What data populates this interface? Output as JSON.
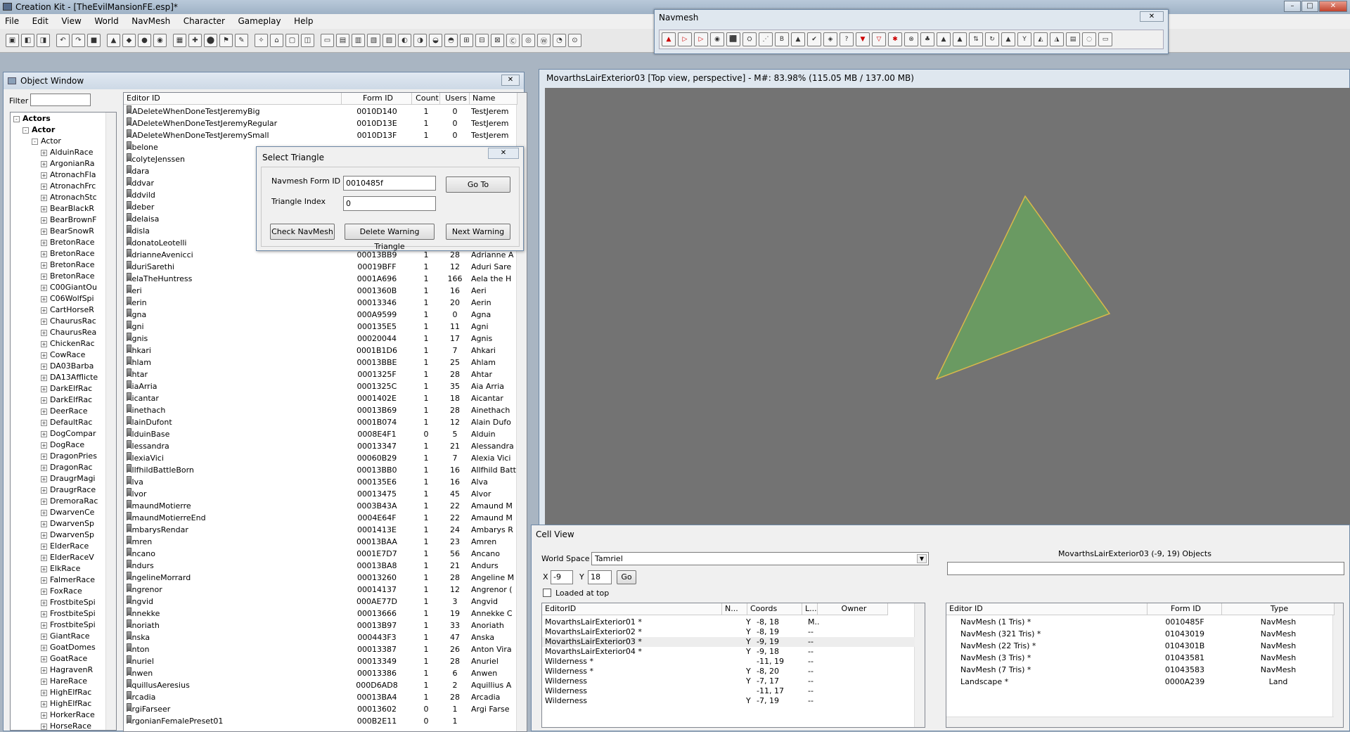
{
  "app": {
    "title": "Creation Kit - [TheEvilMansionFE.esp]*"
  },
  "menu": [
    "File",
    "Edit",
    "View",
    "World",
    "NavMesh",
    "Character",
    "Gameplay",
    "Help"
  ],
  "navmesh_window": {
    "title": "Navmesh",
    "close": "✕"
  },
  "object_window": {
    "title": "Object Window",
    "filter_label": "Filter",
    "filter_value": "",
    "tree": [
      {
        "label": "Actors",
        "bold": true,
        "level": 0,
        "exp": "-"
      },
      {
        "label": "Actor",
        "bold": true,
        "level": 1,
        "exp": "-"
      },
      {
        "label": "Actor",
        "bold": false,
        "level": 2,
        "exp": "-"
      },
      {
        "label": "AlduinRace",
        "level": 3,
        "exp": "+"
      },
      {
        "label": "ArgonianRa",
        "level": 3,
        "exp": "+"
      },
      {
        "label": "AtronachFla",
        "level": 3,
        "exp": "+"
      },
      {
        "label": "AtronachFrc",
        "level": 3,
        "exp": "+"
      },
      {
        "label": "AtronachStc",
        "level": 3,
        "exp": "+"
      },
      {
        "label": "BearBlackR",
        "level": 3,
        "exp": "+"
      },
      {
        "label": "BearBrownF",
        "level": 3,
        "exp": "+"
      },
      {
        "label": "BearSnowR",
        "level": 3,
        "exp": "+"
      },
      {
        "label": "BretonRace",
        "level": 3,
        "exp": "+"
      },
      {
        "label": "BretonRace",
        "level": 3,
        "exp": "+"
      },
      {
        "label": "BretonRace",
        "level": 3,
        "exp": "+"
      },
      {
        "label": "BretonRace",
        "level": 3,
        "exp": "+"
      },
      {
        "label": "C00GiantOu",
        "level": 3,
        "exp": "+"
      },
      {
        "label": "C06WolfSpi",
        "level": 3,
        "exp": "+"
      },
      {
        "label": "CartHorseR",
        "level": 3,
        "exp": "+"
      },
      {
        "label": "ChaurusRac",
        "level": 3,
        "exp": "+"
      },
      {
        "label": "ChaurusRea",
        "level": 3,
        "exp": "+"
      },
      {
        "label": "ChickenRac",
        "level": 3,
        "exp": "+"
      },
      {
        "label": "CowRace",
        "level": 3,
        "exp": "+"
      },
      {
        "label": "DA03Barba",
        "level": 3,
        "exp": "+"
      },
      {
        "label": "DA13Afflicte",
        "level": 3,
        "exp": "+"
      },
      {
        "label": "DarkElfRac",
        "level": 3,
        "exp": "+"
      },
      {
        "label": "DarkElfRac",
        "level": 3,
        "exp": "+"
      },
      {
        "label": "DeerRace",
        "level": 3,
        "exp": "+"
      },
      {
        "label": "DefaultRac",
        "level": 3,
        "exp": "+"
      },
      {
        "label": "DogCompar",
        "level": 3,
        "exp": "+"
      },
      {
        "label": "DogRace",
        "level": 3,
        "exp": "+"
      },
      {
        "label": "DragonPries",
        "level": 3,
        "exp": "+"
      },
      {
        "label": "DragonRac",
        "level": 3,
        "exp": "+"
      },
      {
        "label": "DraugrMagi",
        "level": 3,
        "exp": "+"
      },
      {
        "label": "DraugrRace",
        "level": 3,
        "exp": "+"
      },
      {
        "label": "DremoraRac",
        "level": 3,
        "exp": "+"
      },
      {
        "label": "DwarvenCe",
        "level": 3,
        "exp": "+"
      },
      {
        "label": "DwarvenSp",
        "level": 3,
        "exp": "+"
      },
      {
        "label": "DwarvenSp",
        "level": 3,
        "exp": "+"
      },
      {
        "label": "ElderRace",
        "level": 3,
        "exp": "+"
      },
      {
        "label": "ElderRaceV",
        "level": 3,
        "exp": "+"
      },
      {
        "label": "ElkRace",
        "level": 3,
        "exp": "+"
      },
      {
        "label": "FalmerRace",
        "level": 3,
        "exp": "+"
      },
      {
        "label": "FoxRace",
        "level": 3,
        "exp": "+"
      },
      {
        "label": "FrostbiteSpi",
        "level": 3,
        "exp": "+"
      },
      {
        "label": "FrostbiteSpi",
        "level": 3,
        "exp": "+"
      },
      {
        "label": "FrostbiteSpi",
        "level": 3,
        "exp": "+"
      },
      {
        "label": "GiantRace",
        "level": 3,
        "exp": "+"
      },
      {
        "label": "GoatDomes",
        "level": 3,
        "exp": "+"
      },
      {
        "label": "GoatRace",
        "level": 3,
        "exp": "+"
      },
      {
        "label": "HagravenR",
        "level": 3,
        "exp": "+"
      },
      {
        "label": "HareRace",
        "level": 3,
        "exp": "+"
      },
      {
        "label": "HighElfRac",
        "level": 3,
        "exp": "+"
      },
      {
        "label": "HighElfRac",
        "level": 3,
        "exp": "+"
      },
      {
        "label": "HorkerRace",
        "level": 3,
        "exp": "+"
      },
      {
        "label": "HorseRace",
        "level": 3,
        "exp": "+"
      }
    ],
    "columns": [
      "Editor ID",
      "Form ID",
      "Count",
      "Users",
      "Name"
    ],
    "rows": [
      [
        "AADeleteWhenDoneTestJeremyBig",
        "0010D140",
        "1",
        "0",
        "TestJerem"
      ],
      [
        "AADeleteWhenDoneTestJeremyRegular",
        "0010D13E",
        "1",
        "0",
        "TestJerem"
      ],
      [
        "AADeleteWhenDoneTestJeremySmall",
        "0010D13F",
        "1",
        "0",
        "TestJerem"
      ],
      [
        "Abelone",
        "",
        "",
        "",
        ""
      ],
      [
        "AcolyteJenssen",
        "",
        "",
        "",
        ""
      ],
      [
        "Adara",
        "",
        "",
        "",
        ""
      ],
      [
        "Addvar",
        "",
        "",
        "",
        ""
      ],
      [
        "Addvild",
        "",
        "",
        "",
        ""
      ],
      [
        "Adeber",
        "",
        "",
        "",
        ""
      ],
      [
        "Adelaisa",
        "",
        "",
        "",
        ""
      ],
      [
        "Adisla",
        "",
        "",
        "",
        ""
      ],
      [
        "AdonatoLeotelli",
        "",
        "",
        "",
        ""
      ],
      [
        "AdrianneAvenicci",
        "00013BB9",
        "1",
        "28",
        "Adrianne A"
      ],
      [
        "AduriSarethi",
        "00019BFF",
        "1",
        "12",
        "Aduri Sare"
      ],
      [
        "AelaTheHuntress",
        "0001A696",
        "1",
        "166",
        "Aela the H"
      ],
      [
        "Aeri",
        "0001360B",
        "1",
        "16",
        "Aeri"
      ],
      [
        "Aerin",
        "00013346",
        "1",
        "20",
        "Aerin"
      ],
      [
        "Agna",
        "000A9599",
        "1",
        "0",
        "Agna"
      ],
      [
        "Agni",
        "000135E5",
        "1",
        "11",
        "Agni"
      ],
      [
        "Agnis",
        "00020044",
        "1",
        "17",
        "Agnis"
      ],
      [
        "Ahkari",
        "0001B1D6",
        "1",
        "7",
        "Ahkari"
      ],
      [
        "Ahlam",
        "00013BBE",
        "1",
        "25",
        "Ahlam"
      ],
      [
        "Ahtar",
        "0001325F",
        "1",
        "28",
        "Ahtar"
      ],
      [
        "AiaArria",
        "0001325C",
        "1",
        "35",
        "Aia Arria"
      ],
      [
        "Aicantar",
        "0001402E",
        "1",
        "18",
        "Aicantar"
      ],
      [
        "Ainethach",
        "00013B69",
        "1",
        "28",
        "Ainethach"
      ],
      [
        "AlainDufont",
        "0001B074",
        "1",
        "12",
        "Alain Dufo"
      ],
      [
        "AlduinBase",
        "0008E4F1",
        "0",
        "5",
        "Alduin"
      ],
      [
        "Alessandra",
        "00013347",
        "1",
        "21",
        "Alessandra"
      ],
      [
        "AlexiaVici",
        "00060B29",
        "1",
        "7",
        "Alexia Vici"
      ],
      [
        "AllfhildBattleBorn",
        "00013BB0",
        "1",
        "16",
        "Allfhild Batt"
      ],
      [
        "Alva",
        "000135E6",
        "1",
        "16",
        "Alva"
      ],
      [
        "Alvor",
        "00013475",
        "1",
        "45",
        "Alvor"
      ],
      [
        "AmaundMotierre",
        "0003B43A",
        "1",
        "22",
        "Amaund M"
      ],
      [
        "AmaundMotierreEnd",
        "0004E64F",
        "1",
        "22",
        "Amaund M"
      ],
      [
        "AmbarysRendar",
        "0001413E",
        "1",
        "24",
        "Ambarys R"
      ],
      [
        "Amren",
        "00013BAA",
        "1",
        "23",
        "Amren"
      ],
      [
        "Ancano",
        "0001E7D7",
        "1",
        "56",
        "Ancano"
      ],
      [
        "Andurs",
        "00013BA8",
        "1",
        "21",
        "Andurs"
      ],
      [
        "AngelineMorrard",
        "00013260",
        "1",
        "28",
        "Angeline M"
      ],
      [
        "Angrenor",
        "00014137",
        "1",
        "12",
        "Angrenor ("
      ],
      [
        "Angvid",
        "000AE77D",
        "1",
        "3",
        "Angvid"
      ],
      [
        "Annekke",
        "00013666",
        "1",
        "19",
        "Annekke C"
      ],
      [
        "Anoriath",
        "00013B97",
        "1",
        "33",
        "Anoriath"
      ],
      [
        "Anska",
        "000443F3",
        "1",
        "47",
        "Anska"
      ],
      [
        "Anton",
        "00013387",
        "1",
        "26",
        "Anton Vira"
      ],
      [
        "Anuriel",
        "00013349",
        "1",
        "28",
        "Anuriel"
      ],
      [
        "Anwen",
        "00013386",
        "1",
        "6",
        "Anwen"
      ],
      [
        "AquillusAeresius",
        "000D6AD8",
        "1",
        "2",
        "Aquillius A"
      ],
      [
        "Arcadia",
        "00013BA4",
        "1",
        "28",
        "Arcadia"
      ],
      [
        "ArgiFarseer",
        "00013602",
        "0",
        "1",
        "Argi Farse"
      ],
      [
        "ArgonianFemalePreset01",
        "000B2E11",
        "0",
        "1",
        ""
      ]
    ]
  },
  "select_triangle": {
    "title": "Select Triangle",
    "close": "✕",
    "navmesh_form_id_label": "Navmesh Form ID",
    "navmesh_form_id_value": "0010485f",
    "triangle_index_label": "Triangle Index",
    "triangle_index_value": "0",
    "goto": "Go To",
    "check": "Check NavMesh",
    "delete_warning": "Delete Warning Triangle",
    "next_warning": "Next Warning"
  },
  "render_window": {
    "title": "MovarthsLairExterior03 [Top view, perspective] - M#: 83.98% (115.05 MB / 137.00 MB)",
    "bg": "#737373",
    "triangle_fill": "#6a9a62",
    "triangle_edge": "#d8b84a"
  },
  "cell_view": {
    "title": "Cell View",
    "world_space_label": "World Space",
    "world_space_value": "Tamriel",
    "x_label": "X",
    "x_value": "-9",
    "y_label": "Y",
    "y_value": "18",
    "go": "Go",
    "loaded_at_top": "Loaded at top",
    "objects_title": "MovarthsLairExterior03 (-9, 19) Objects",
    "cells_columns": [
      "EditorID",
      "N...",
      "Coords",
      "L...",
      "Owner"
    ],
    "cells": [
      [
        "MovarthsLairExterior01 *",
        "Y",
        "-8, 18",
        "M..",
        ""
      ],
      [
        "MovarthsLairExterior02 *",
        "Y",
        "-8, 19",
        "--",
        ""
      ],
      [
        "MovarthsLairExterior03 *",
        "Y",
        "-9, 19",
        "--",
        ""
      ],
      [
        "MovarthsLairExterior04 *",
        "Y",
        "-9, 18",
        "--",
        ""
      ],
      [
        "Wilderness *",
        "",
        "-11, 19",
        "--",
        ""
      ],
      [
        "Wilderness *",
        "Y",
        "-8, 20",
        "--",
        ""
      ],
      [
        "Wilderness",
        "Y",
        "-7, 17",
        "--",
        ""
      ],
      [
        "Wilderness",
        "",
        "-11, 17",
        "--",
        ""
      ],
      [
        "Wilderness",
        "Y",
        "-7, 19",
        "--",
        ""
      ]
    ],
    "objects_columns": [
      "Editor ID",
      "Form ID",
      "Type"
    ],
    "objects": [
      [
        "NavMesh (1 Tris) *",
        "0010485F",
        "NavMesh"
      ],
      [
        "NavMesh (321 Tris) *",
        "01043019",
        "NavMesh"
      ],
      [
        "NavMesh (22 Tris) *",
        "0104301B",
        "NavMesh"
      ],
      [
        "NavMesh (3 Tris) *",
        "01043581",
        "NavMesh"
      ],
      [
        "NavMesh (7 Tris) *",
        "01043583",
        "NavMesh"
      ],
      [
        "Landscape *",
        "0000A239",
        "Land"
      ]
    ]
  },
  "window_buttons": {
    "min": "–",
    "max": "□",
    "close": "✕"
  }
}
